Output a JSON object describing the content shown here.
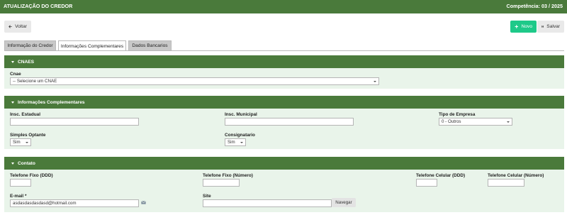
{
  "header": {
    "title": "ATUALIZAÇÃO DO CREDOR",
    "competencia": "Competência: 03 / 2025"
  },
  "toolbar": {
    "back_label": "Voltar",
    "new_label": "Novo",
    "save_label": "Salvar"
  },
  "tabs": [
    {
      "label": "Informação do Credor",
      "active": false
    },
    {
      "label": "Informações Complementares",
      "active": true
    },
    {
      "label": "Dados Bancarios",
      "active": false
    }
  ],
  "cnaes": {
    "section_title": "CNAES",
    "cnae_label": "Cnae",
    "cnae_value": "-- Selecione um CNAE"
  },
  "complementares": {
    "section_title": "Informações Complementares",
    "insc_estadual_label": "Insc. Estadual",
    "insc_estadual_value": "",
    "insc_municipal_label": "Insc. Municipal",
    "insc_municipal_value": "",
    "tipo_empresa_label": "Tipo de Empresa",
    "tipo_empresa_value": "0 - Outros",
    "simples_label": "Simples Optante",
    "simples_value": "Sim",
    "consignatario_label": "Consignatario",
    "consignatario_value": "Sim"
  },
  "contato": {
    "section_title": "Contato",
    "tel_fixo_ddd_label": "Telefone Fixo (DDD)",
    "tel_fixo_num_label": "Telefone Fixo (Número)",
    "tel_cel_ddd_label": "Telefone Celular (DDD)",
    "tel_cel_num_label": "Telefone Celular (Número)",
    "email_label": "E-mail *",
    "email_value": "asdasdasdasdasd@hotmail.com",
    "site_label": "Site",
    "site_value": "",
    "navegar_label": "Navegar"
  },
  "colors": {
    "header_green": "#4a7a3b",
    "panel_bg": "#e9f4ea",
    "novo_button": "#1ec989"
  },
  "icons": {
    "back": "arrow-left-icon",
    "new": "plus-icon",
    "save": "floppy-disk-icon",
    "email": "envelope-icon",
    "collapse": "caret-down-icon"
  }
}
